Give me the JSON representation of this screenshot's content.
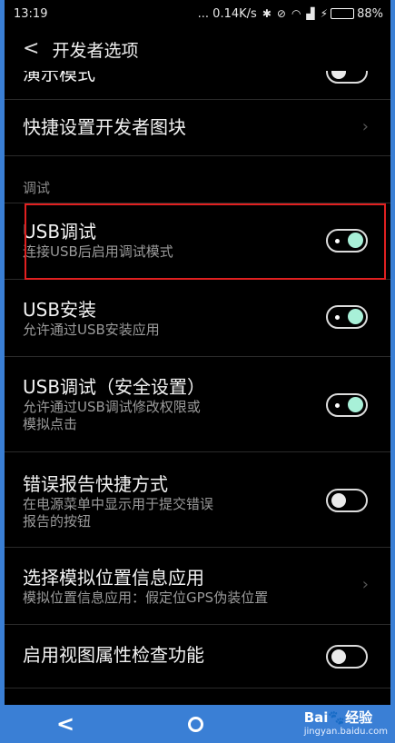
{
  "status_bar": {
    "time": "13:19",
    "net_speed": "... 0.14K/s",
    "battery_percent": "88%",
    "battery_level": 0.88,
    "icons": [
      "bluetooth-icon",
      "alarm-off-icon",
      "wifi-icon",
      "signal-icon",
      "charging-icon"
    ]
  },
  "header": {
    "back_glyph": "<",
    "title": "开发者选项"
  },
  "items": {
    "demo_mode": {
      "title": "演示模式",
      "toggle": false
    },
    "quick_tiles": {
      "title": "快捷设置开发者图块"
    },
    "section_debug": "调试",
    "usb_debug": {
      "title": "USB调试",
      "subtitle": "连接USB后启用调试模式",
      "toggle": true
    },
    "usb_install": {
      "title": "USB安装",
      "subtitle": "允许通过USB安装应用",
      "toggle": true
    },
    "usb_debug_secure": {
      "title": "USB调试（安全设置）",
      "subtitle_line1": "允许通过USB调试修改权限或",
      "subtitle_line2": "模拟点击",
      "toggle": true
    },
    "bug_report": {
      "title": "错误报告快捷方式",
      "subtitle_line1": "在电源菜单中显示用于提交错误",
      "subtitle_line2": "报告的按钮",
      "toggle": false
    },
    "mock_location": {
      "title": "选择模拟位置信息应用",
      "subtitle": "模拟位置信息应用：假定位GPS伪装位置"
    },
    "view_attr": {
      "title": "启用视图属性检查功能",
      "toggle": false
    }
  },
  "nav_bar": {
    "back_glyph": "<",
    "watermark_top": "Bai🐾经验",
    "watermark_bottom": "jingyan.baidu.com"
  },
  "colors": {
    "highlight": "#e02020",
    "toggle_on_knob": "#a8f0d8",
    "nav_bar": "#3a7fd5"
  }
}
